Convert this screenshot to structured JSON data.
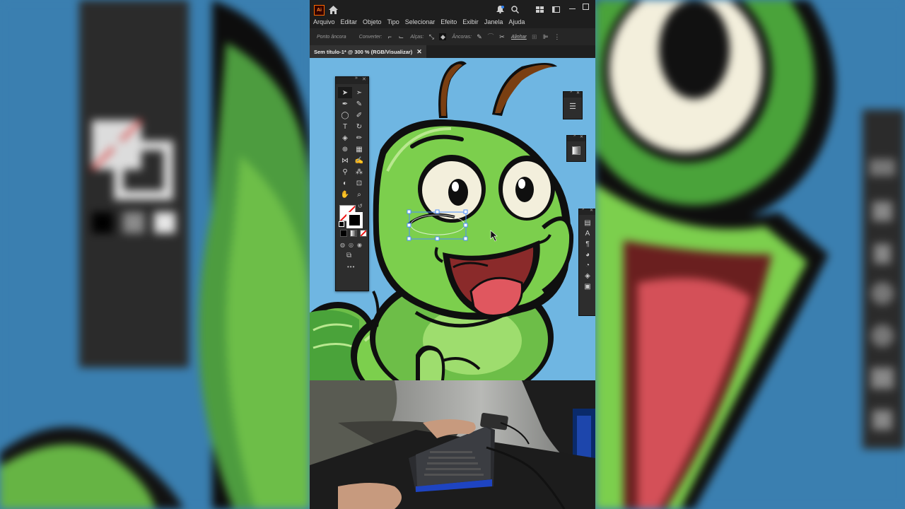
{
  "app": {
    "logo_text": "Ai",
    "menu": [
      "Arquivo",
      "Editar",
      "Objeto",
      "Tipo",
      "Selecionar",
      "Efeito",
      "Exibir",
      "Janela",
      "Ajuda"
    ]
  },
  "control_bar": {
    "anchor_label": "Ponto âncora",
    "convert_label": "Converter:",
    "handles_label": "Alças:",
    "anchors_label": "Âncoras:",
    "align_label": "Alinhar"
  },
  "document": {
    "tab_title": "Sem título-1* @ 300 % (RGB/Visualizar)",
    "close_glyph": "✕"
  },
  "colors": {
    "canvas_bg": "#6fb6e2",
    "caterpillar_green": "#7ccf4d",
    "caterpillar_dark": "#4aa33a",
    "outline": "#0f0f0f",
    "antenna": "#7a3f12",
    "tongue": "#e0575f",
    "mouth": "#8a2a2a"
  },
  "toolbar": {
    "more_glyph": "•••"
  }
}
